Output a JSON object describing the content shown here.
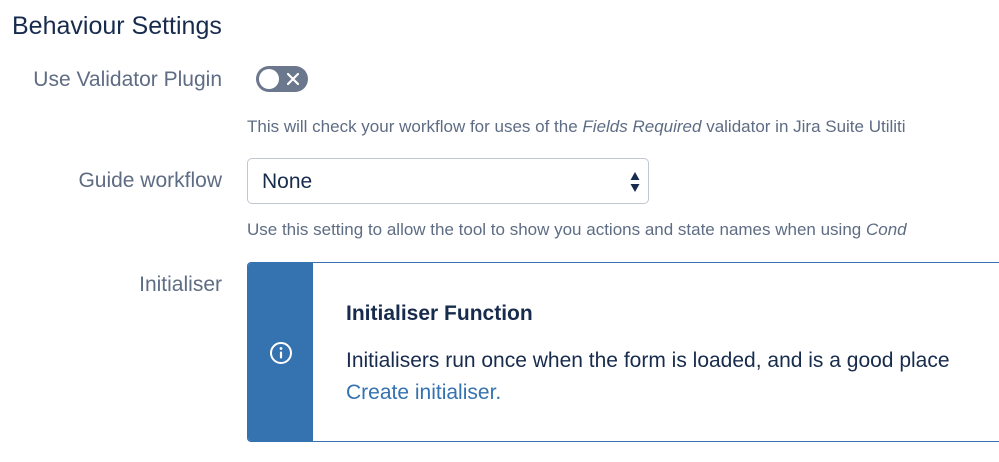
{
  "section": {
    "title": "Behaviour Settings"
  },
  "validator": {
    "label": "Use Validator Plugin",
    "enabled": false,
    "help_prefix": "This will check your workflow for uses of the ",
    "help_emphasis": "Fields Required",
    "help_suffix": " validator in Jira Suite Utiliti"
  },
  "guide_workflow": {
    "label": "Guide workflow",
    "selected": "None",
    "help_prefix": "Use this setting to allow the tool to show you actions and state names when using ",
    "help_emphasis": "Cond"
  },
  "initialiser": {
    "label": "Initialiser",
    "panel_title": "Initialiser Function",
    "panel_body": "Initialisers run once when the form is loaded, and is a good place",
    "link_text": "Create initialiser."
  },
  "icons": {
    "toggle_off": "close-icon",
    "select_arrows": "sort-arrows-icon",
    "info": "info-circle-icon"
  },
  "colors": {
    "accent": "#3572b0",
    "toggle_off": "#6b778c",
    "text": "#172b4d",
    "muted_text": "#5e6c84"
  }
}
